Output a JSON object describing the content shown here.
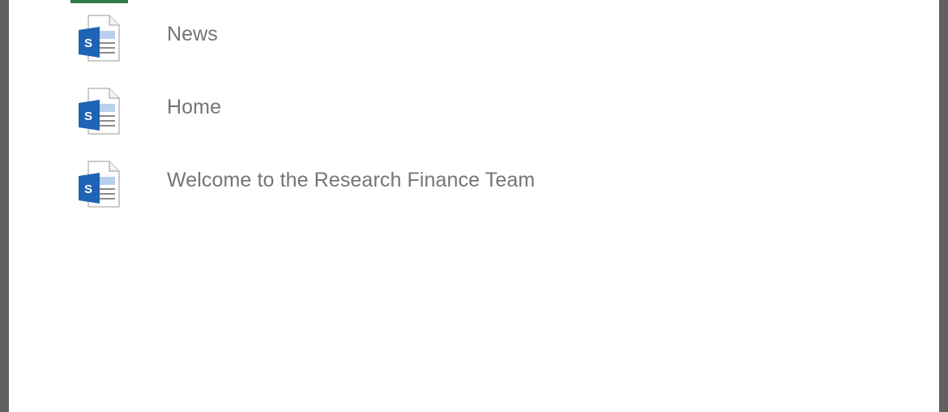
{
  "list": {
    "items": [
      {
        "label": "News",
        "icon": "sharepoint-page-icon"
      },
      {
        "label": "Home",
        "icon": "sharepoint-page-icon"
      },
      {
        "label": "Welcome to the Research Finance Team",
        "icon": "sharepoint-page-icon"
      }
    ]
  },
  "colors": {
    "accent": "#2f7a47",
    "sharepoint_blue": "#1f63b4",
    "label_text": "#757575"
  }
}
